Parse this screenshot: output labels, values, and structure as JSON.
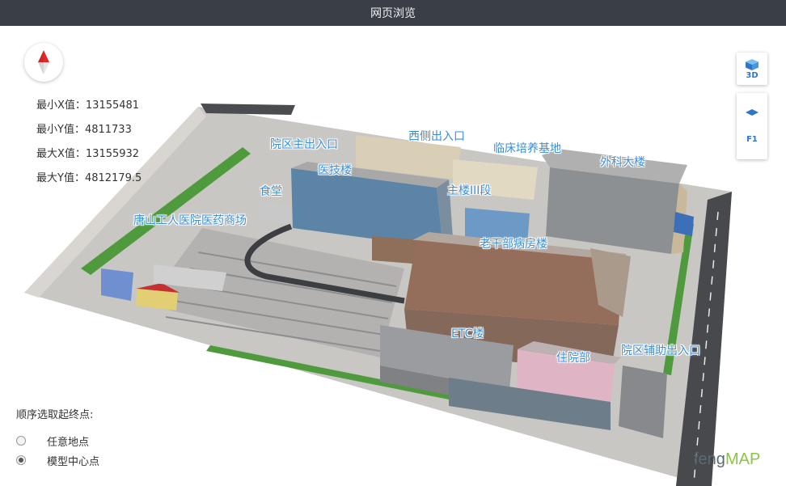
{
  "window": {
    "title": "网页浏览"
  },
  "bounds": {
    "min_x": "最小X值：13155481",
    "min_y": "最小Y值：4811733",
    "max_x": "最大X值：13155932",
    "max_y": "最大Y值：4812179.5"
  },
  "controls": {
    "view_mode": "3D",
    "floor": "F1"
  },
  "labels": {
    "main_entrance": "院区主出入口",
    "west_entrance": "西侧出入口",
    "clinical_base": "临床培养基地",
    "surgery": "外科大楼",
    "medtech": "医技楼",
    "canteen": "食堂",
    "main_building_3": "主楼III段",
    "pharmacy": "唐山工人医院医药商场",
    "cadre_ward": "老干部病房楼",
    "etc": "ETC楼",
    "inpatient": "住院部",
    "aux_entrance": "院区辅助出入口"
  },
  "route": {
    "heading": "顺序选取起终点:",
    "options": [
      "任意地点",
      "模型中心点"
    ],
    "selected_index": 1
  },
  "logo": {
    "prefix": "feng",
    "suffix": "MAP"
  },
  "colors": {
    "label": "#3a8ed8",
    "accent": "#2f76c9",
    "titlebar": "#3a3f47"
  },
  "icons": {
    "compass": "compass-icon",
    "view3d": "cube-3d-icon",
    "floor": "floor-layer-icon"
  }
}
